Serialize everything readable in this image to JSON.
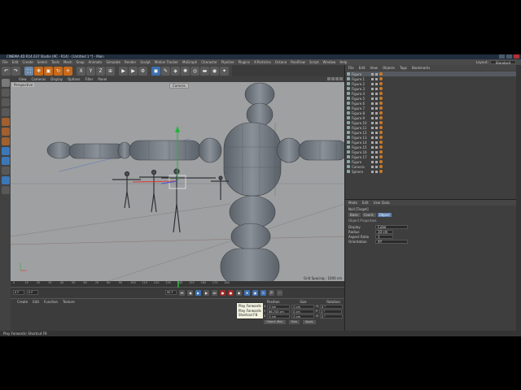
{
  "window": {
    "title": "CINEMA 4D R14.037 Studio (RC - R14) - [Untitled 1 *] - Main"
  },
  "menu": [
    "File",
    "Edit",
    "Create",
    "Select",
    "Tools",
    "Mesh",
    "Snap",
    "Animate",
    "Simulate",
    "Render",
    "Sculpt",
    "Motion Tracker",
    "MoGraph",
    "Character",
    "Pipeline",
    "Plugins",
    "X-Particles",
    "Octane",
    "RealFlow",
    "Script",
    "Window",
    "Help"
  ],
  "layout": {
    "label": "Layout:",
    "value": "Standard"
  },
  "toolbar": {
    "buttons": [
      "undo-icon",
      "redo-icon",
      "select-icon",
      "move-icon",
      "scale-icon",
      "rotate-icon",
      "x-axis",
      "y-axis",
      "z-axis",
      "coord-icon",
      "render-view",
      "render-picture",
      "render-settings",
      "cube-icon",
      "pen-icon",
      "subdivision-icon",
      "array-icon",
      "deformer-icon",
      "floor-icon",
      "camera-icon",
      "light-icon"
    ],
    "axis_labels": {
      "x": "X",
      "y": "Y",
      "z": "Z"
    }
  },
  "viewport": {
    "menu": [
      "View",
      "Cameras",
      "Display",
      "Options",
      "Filter",
      "Panel"
    ],
    "label": "Perspective",
    "camera_label": "Camera",
    "grid_spacing": "Grid Spacing : 1000 cm",
    "background": "#9ea0a1"
  },
  "timeline": {
    "ticks": [
      "0",
      "10",
      "20",
      "30",
      "40",
      "50",
      "60",
      "70",
      "80",
      "90",
      "100",
      "110",
      "120",
      "130",
      "140",
      "150",
      "160",
      "170",
      "180"
    ],
    "current_frame": "0 F",
    "start": "0 F",
    "end": "90 F",
    "playhead_frame": 140
  },
  "tooltip": {
    "lines": [
      "Play Forwards",
      "Play Forwards",
      "Shortcut F8"
    ]
  },
  "materials": {
    "menu": [
      "Create",
      "Edit",
      "Function",
      "Texture"
    ]
  },
  "coordinates": {
    "headers": [
      "Position",
      "Size",
      "Rotation"
    ],
    "rows": [
      {
        "axis": "X",
        "pos": "0 cm",
        "size": "0 cm",
        "rot_label": "H",
        "rot": "0 °"
      },
      {
        "axis": "Y",
        "pos": "66.743 cm",
        "size": "0 cm",
        "rot_label": "P",
        "rot": "0 °"
      },
      {
        "axis": "Z",
        "pos": "0 cm",
        "size": "0 cm",
        "rot_label": "B",
        "rot": "0 °"
      }
    ],
    "mode_object": "Object (Rel)",
    "mode_size": "Size",
    "apply": "Apply"
  },
  "status": {
    "text": "Play Forwards: Shortcut F8"
  },
  "object_manager": {
    "menu": [
      "File",
      "Edit",
      "View",
      "Objects",
      "Tags",
      "Bookmarks"
    ],
    "objects": [
      {
        "name": "Figure",
        "selected": true
      },
      {
        "name": "Figure.1",
        "selected": false
      },
      {
        "name": "Figure.2",
        "selected": false
      },
      {
        "name": "Figure.3",
        "selected": false
      },
      {
        "name": "Figure.4",
        "selected": false
      },
      {
        "name": "Figure.5",
        "selected": false
      },
      {
        "name": "Figure.6",
        "selected": false
      },
      {
        "name": "Figure.7",
        "selected": false
      },
      {
        "name": "Figure.8",
        "selected": false
      },
      {
        "name": "Figure.9",
        "selected": false
      },
      {
        "name": "Figure.10",
        "selected": false
      },
      {
        "name": "Figure.11",
        "selected": false
      },
      {
        "name": "Figure.12",
        "selected": false
      },
      {
        "name": "Figure.13",
        "selected": false
      },
      {
        "name": "Figure.14",
        "selected": false
      },
      {
        "name": "Figure.15",
        "selected": false
      },
      {
        "name": "Figure.16",
        "selected": false
      },
      {
        "name": "Figure.17",
        "selected": false
      },
      {
        "name": "Figure",
        "selected": false
      },
      {
        "name": "Camera",
        "selected": false
      },
      {
        "name": "Sphere",
        "selected": false
      }
    ]
  },
  "attributes": {
    "menu": [
      "Mode",
      "Edit",
      "User Data"
    ],
    "header": "Null [Target]",
    "tabs": [
      {
        "label": "Basic",
        "on": false
      },
      {
        "label": "Coord.",
        "on": false
      },
      {
        "label": "Object",
        "on": true
      }
    ],
    "section": "Object Properties",
    "props": [
      {
        "label": "Display",
        "value": "Cube"
      },
      {
        "label": "Radius",
        "value": "10 cm"
      },
      {
        "label": "Aspect Ratio",
        "value": "1"
      },
      {
        "label": "Orientation",
        "value": "XY"
      }
    ]
  }
}
